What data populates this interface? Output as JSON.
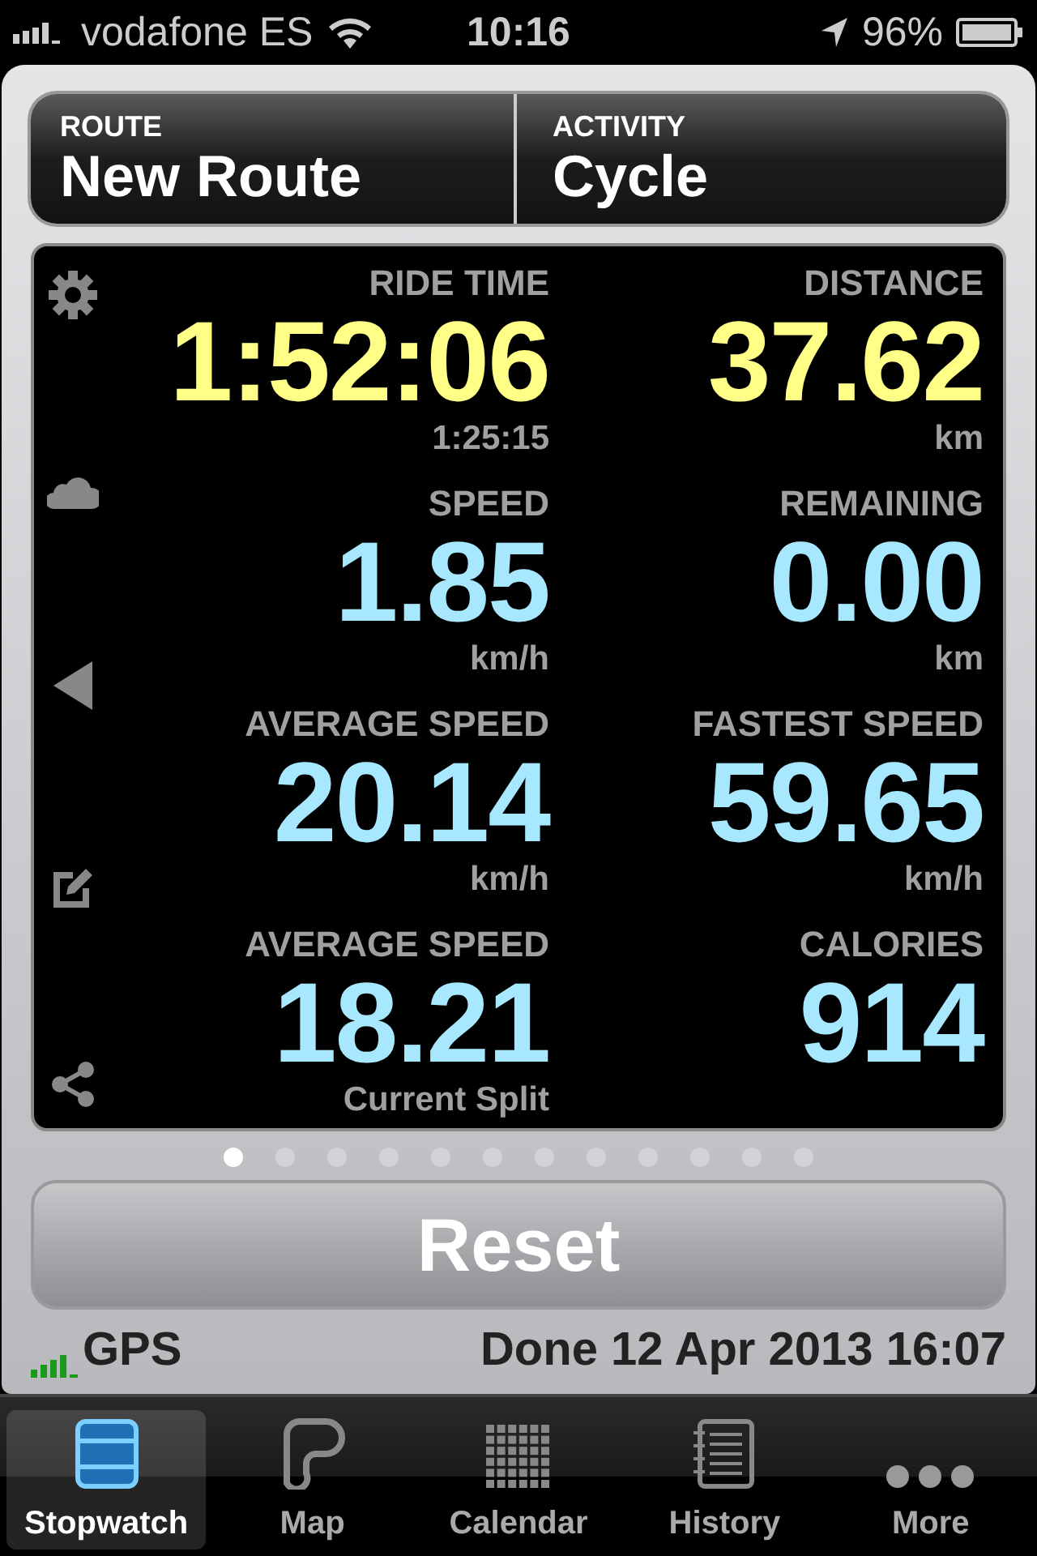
{
  "status_bar": {
    "carrier": "vodafone ES",
    "time": "10:16",
    "battery": "96%"
  },
  "header": [
    {
      "label": "ROUTE",
      "value": "New Route"
    },
    {
      "label": "ACTIVITY",
      "value": "Cycle"
    }
  ],
  "stats": [
    {
      "label": "RIDE TIME",
      "value": "1:52:06",
      "sub": "1:25:15",
      "color": "#ffff88"
    },
    {
      "label": "DISTANCE",
      "value": "37.62",
      "sub": "km",
      "color": "#ffff88"
    },
    {
      "label": "SPEED",
      "value": "1.85",
      "sub": "km/h",
      "color": "#a8e8ff"
    },
    {
      "label": "REMAINING",
      "value": "0.00",
      "sub": "km",
      "color": "#a8e8ff"
    },
    {
      "label": "AVERAGE SPEED",
      "value": "20.14",
      "sub": "km/h",
      "color": "#a8e8ff"
    },
    {
      "label": "FASTEST SPEED",
      "value": "59.65",
      "sub": "km/h",
      "color": "#a8e8ff"
    },
    {
      "label": "AVERAGE SPEED",
      "value": "18.21",
      "sub": "Current Split",
      "color": "#a8e8ff"
    },
    {
      "label": "CALORIES",
      "value": "914",
      "color": "#a8e8ff"
    }
  ],
  "page_dots": [
    {
      "selected": true
    },
    {
      "selected": false
    },
    {
      "selected": false
    },
    {
      "selected": false
    },
    {
      "selected": false
    },
    {
      "selected": false
    },
    {
      "selected": false
    },
    {
      "selected": false
    },
    {
      "selected": false
    },
    {
      "selected": false
    },
    {
      "selected": false
    },
    {
      "selected": false
    }
  ],
  "reset_button": "Reset",
  "footer": {
    "gps": "GPS",
    "done": "Done 12 Apr 2013 16:07"
  },
  "tabs": [
    {
      "kind": "stopwatch",
      "label": "Stopwatch",
      "selected": true
    },
    {
      "kind": "map",
      "label": "Map",
      "selected": false
    },
    {
      "kind": "calendar",
      "label": "Calendar",
      "selected": false
    },
    {
      "kind": "history",
      "label": "History",
      "selected": false
    },
    {
      "kind": "more",
      "label": "More",
      "selected": false
    }
  ]
}
